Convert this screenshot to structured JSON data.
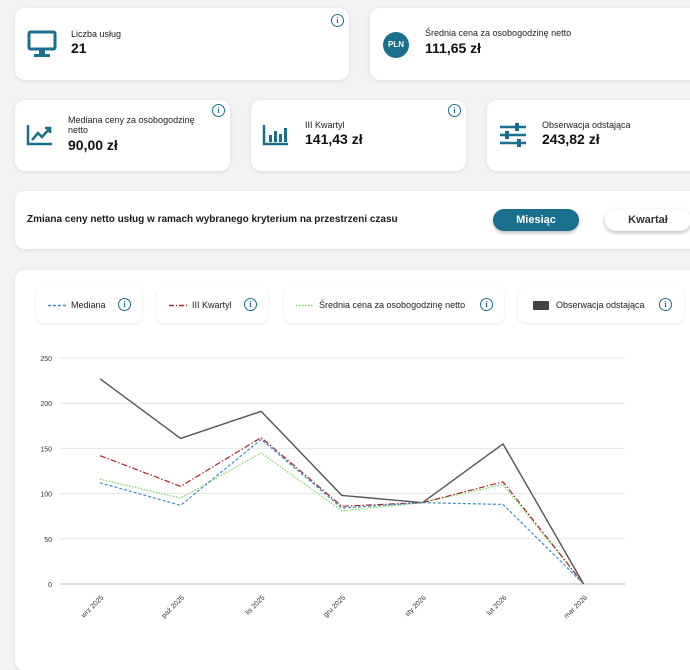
{
  "cards": {
    "service_count": {
      "label": "Liczba usług",
      "value": "21",
      "icon": "monitor-icon"
    },
    "avg_price": {
      "label": "Średnia cena za osobogodzinę netto",
      "value": "111,65 zł",
      "badge": "PLN"
    },
    "median_price": {
      "label": "Mediana ceny za osobogodzinę netto",
      "value": "90,00 zł",
      "icon": "trend-up-icon"
    },
    "q3": {
      "label": "III Kwartyl",
      "value": "141,43 zł",
      "icon": "bar-chart-icon"
    },
    "outlier": {
      "label": "Obserwacja odstająca",
      "value": "243,82 zł",
      "icon": "sliders-icon"
    }
  },
  "filter": {
    "title": "Zmiana ceny netto usług w ramach wybranego kryterium na przestrzeni czasu",
    "month_label": "Miesiąc",
    "quarter_label": "Kwartał"
  },
  "legend": {
    "median": "Mediana",
    "q3": "III Kwartyl",
    "avg": "Średnia cena za osobogodzinę netto",
    "outlier": "Obserwacja odstająca"
  },
  "colors": {
    "accent": "#1a6f8c",
    "median": "#3b8fc4",
    "q3": "#a8252b",
    "avg": "#7ed957",
    "outlier": "#555555"
  },
  "chart_data": {
    "type": "line",
    "categories": [
      "wrz 2025",
      "paź 2025",
      "lis 2025",
      "gru 2025",
      "sty 2026",
      "lut 2026",
      "mar 2026"
    ],
    "ylim": [
      0,
      250
    ],
    "yticks": [
      0,
      50,
      100,
      150,
      200,
      250
    ],
    "grid": true,
    "series": [
      {
        "name": "Mediana",
        "values": [
          112,
          87,
          160,
          84,
          90,
          88,
          0
        ]
      },
      {
        "name": "III Kwartyl",
        "values": [
          142,
          108,
          162,
          86,
          90,
          113,
          0
        ]
      },
      {
        "name": "Średnia cena za osobogodzinę netto",
        "values": [
          116,
          95,
          145,
          81,
          90,
          110,
          0
        ]
      },
      {
        "name": "Obserwacja odstająca",
        "values": [
          227,
          161,
          191,
          98,
          90,
          155,
          0
        ]
      }
    ]
  }
}
